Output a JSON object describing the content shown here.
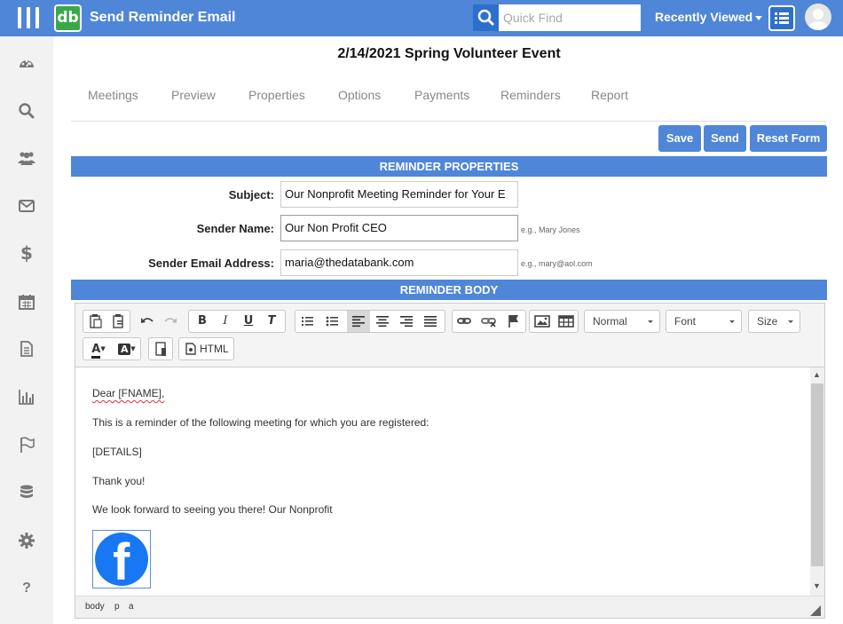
{
  "header": {
    "app_title": "Send Reminder Email",
    "logo_text": "db",
    "search_placeholder": "Quick Find",
    "recently_viewed": "Recently Viewed"
  },
  "sidebar": {
    "items": [
      "dashboard-icon",
      "search-icon",
      "people-icon",
      "mail-icon",
      "dollar-icon",
      "calendar-icon",
      "document-icon",
      "chart-icon",
      "flag-icon",
      "database-icon",
      "gear-icon",
      "help-icon"
    ],
    "help_glyph": "?",
    "dollar_glyph": "$"
  },
  "event": {
    "title": "2/14/2021 Spring Volunteer Event"
  },
  "tabs": [
    "Meetings",
    "Preview",
    "Properties",
    "Options",
    "Payments",
    "Reminders",
    "Report"
  ],
  "actions": {
    "save": "Save",
    "send": "Send",
    "reset": "Reset Form"
  },
  "properties": {
    "header": "REMINDER PROPERTIES",
    "subject_label": "Subject:",
    "subject_value": "Our Nonprofit Meeting Reminder for Your E",
    "sender_name_label": "Sender Name:",
    "sender_name_value": "Our Non Profit CEO",
    "sender_name_hint": "e.g., Mary Jones",
    "sender_email_label": "Sender Email Address:",
    "sender_email_value": "maria@thedatabank.com",
    "sender_email_hint": "e.g., mary@aol.com"
  },
  "body": {
    "header": "REMINDER BODY",
    "toolbar": {
      "bold": "B",
      "italic": "I",
      "underline": "U",
      "clear_format": "T",
      "format_combo": "Normal",
      "font_combo": "Font",
      "size_combo": "Size",
      "text_color": "A",
      "bg_color": "A",
      "html_label": "HTML"
    },
    "lines": [
      "Dear [FNAME],",
      "This is a reminder of the following meeting for which you are registered:",
      "[DETAILS]",
      "Thank you!",
      "We look forward to seeing you there! Our Nonprofit"
    ],
    "facebook_glyph": "f",
    "path": [
      "body",
      "p",
      "a"
    ],
    "colors": {
      "accent": "#4f86d8",
      "facebook": "#1877f2"
    }
  }
}
